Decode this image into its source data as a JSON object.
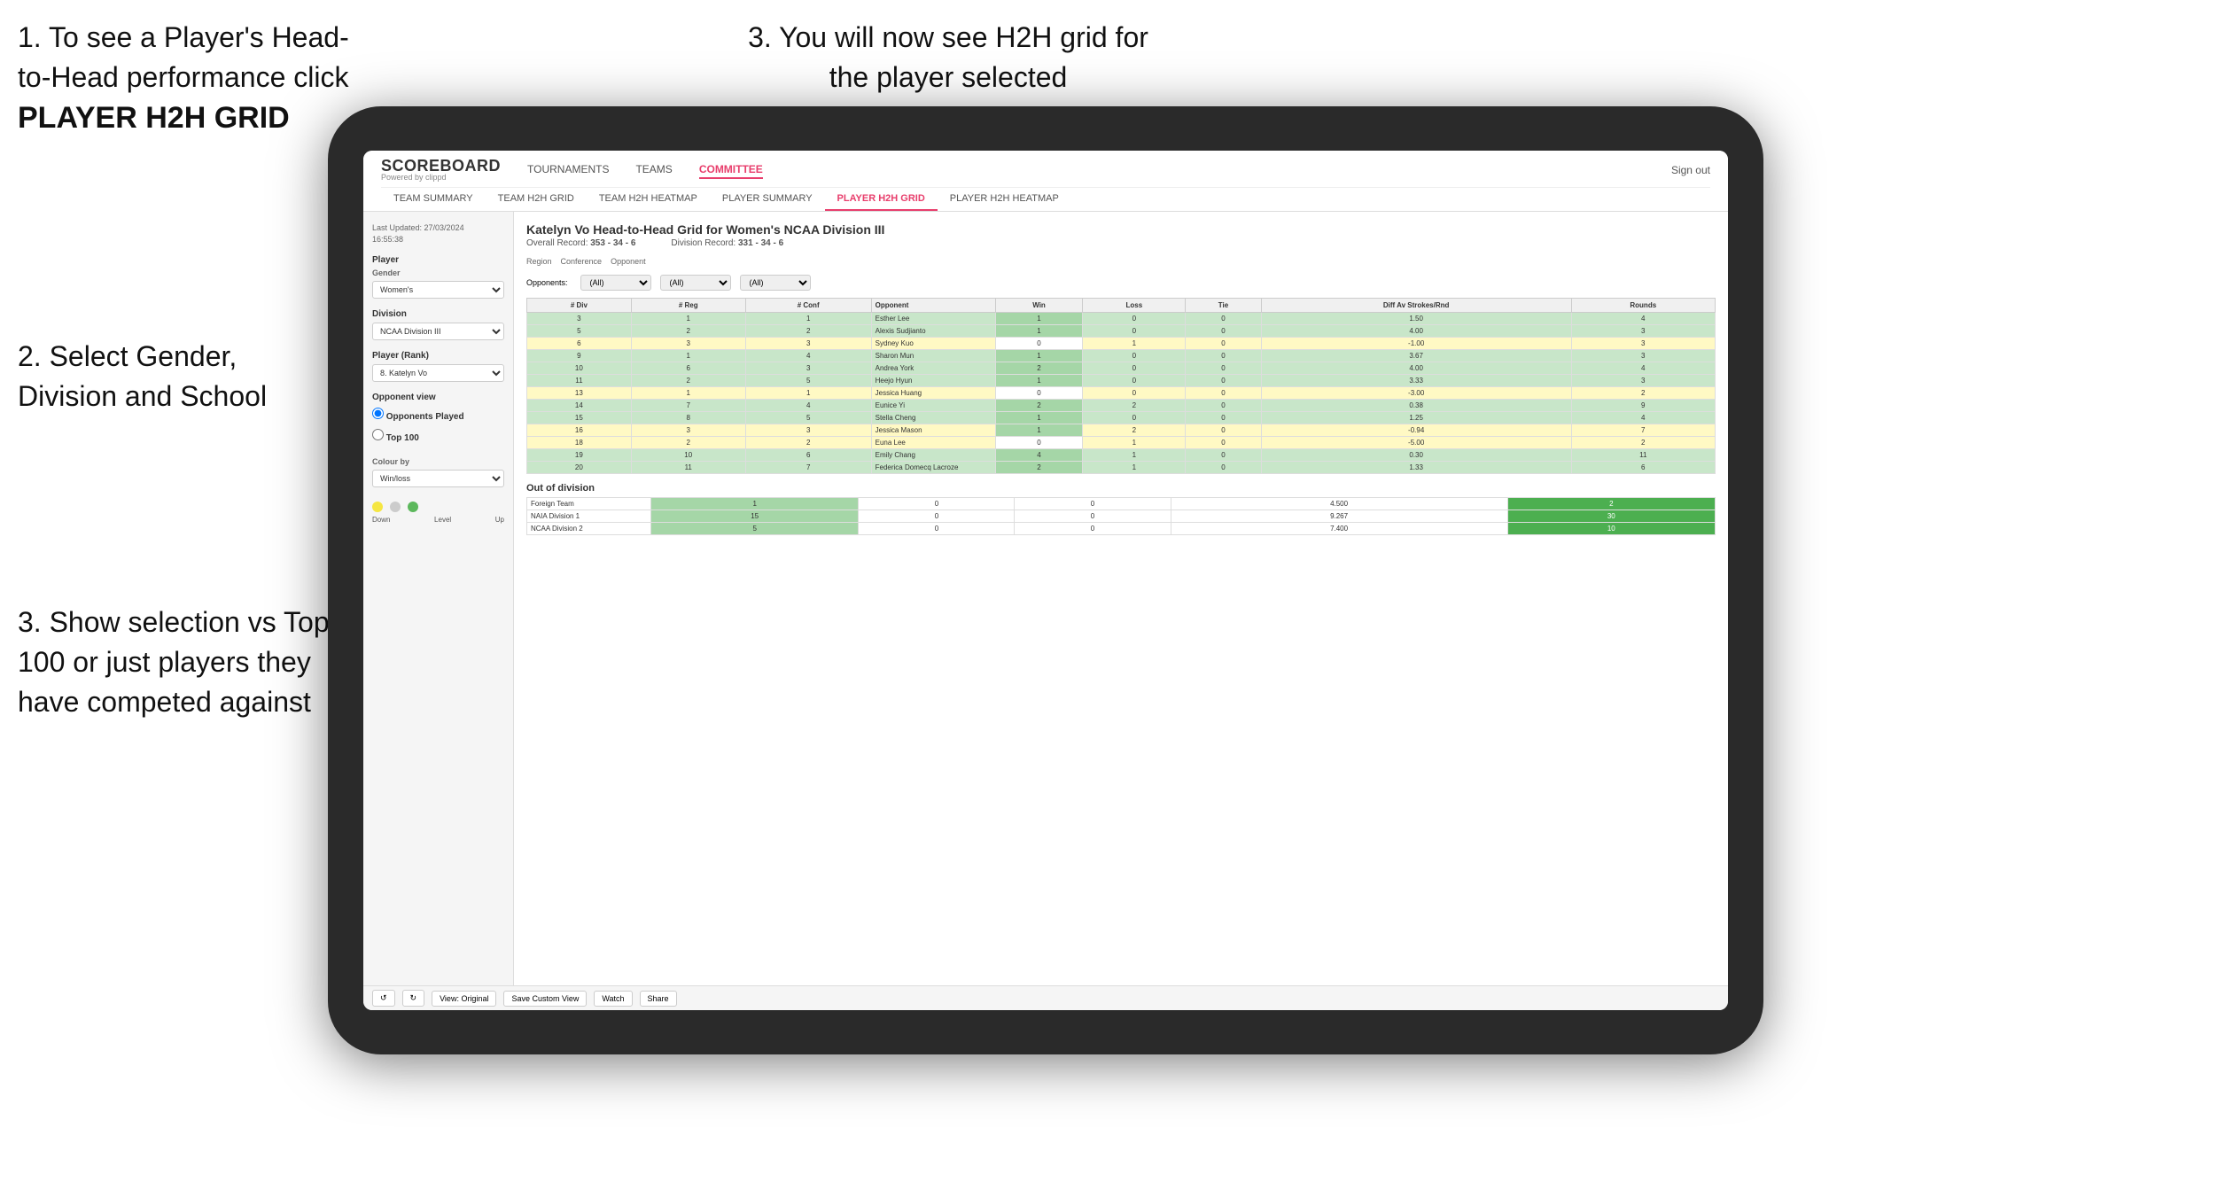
{
  "instructions": {
    "step1_text": "1. To see a Player's Head-to-Head performance click",
    "step1_bold": "PLAYER H2H GRID",
    "step2_text": "2. Select Gender, Division and School",
    "step3_left_text": "3. Show selection vs Top 100 or just players they have competed against",
    "step3_right_text": "3. You will now see H2H grid for the player selected"
  },
  "nav": {
    "logo": "SCOREBOARD",
    "logo_sub": "Powered by clippd",
    "links": [
      "TOURNAMENTS",
      "TEAMS",
      "COMMITTEE"
    ],
    "sign_out": "Sign out",
    "sub_links": [
      "TEAM SUMMARY",
      "TEAM H2H GRID",
      "TEAM H2H HEATMAP",
      "PLAYER SUMMARY",
      "PLAYER H2H GRID",
      "PLAYER H2H HEATMAP"
    ]
  },
  "sidebar": {
    "timestamp_label": "Last Updated: 27/03/2024",
    "timestamp_time": "16:55:38",
    "player_label": "Player",
    "gender_label": "Gender",
    "gender_value": "Women's",
    "division_label": "Division",
    "division_value": "NCAA Division III",
    "player_rank_label": "Player (Rank)",
    "player_rank_value": "8. Katelyn Vo",
    "opponent_view_label": "Opponent view",
    "radio1": "Opponents Played",
    "radio2": "Top 100",
    "colour_by_label": "Colour by",
    "colour_by_value": "Win/loss",
    "legend_down": "Down",
    "legend_level": "Level",
    "legend_up": "Up"
  },
  "grid": {
    "title": "Katelyn Vo Head-to-Head Grid for Women's NCAA Division III",
    "overall_record_label": "Overall Record:",
    "overall_record": "353 - 34 - 6",
    "division_record_label": "Division Record:",
    "division_record": "331 - 34 - 6",
    "filter_region_label": "Region",
    "filter_conference_label": "Conference",
    "filter_opponent_label": "Opponent",
    "filter_opponents_label": "Opponents:",
    "filter_all": "(All)",
    "col_div": "# Div",
    "col_reg": "# Reg",
    "col_conf": "# Conf",
    "col_opponent": "Opponent",
    "col_win": "Win",
    "col_loss": "Loss",
    "col_tie": "Tie",
    "col_diff": "Diff Av Strokes/Rnd",
    "col_rounds": "Rounds",
    "rows": [
      {
        "div": 3,
        "reg": 1,
        "conf": 1,
        "opponent": "Esther Lee",
        "win": 1,
        "loss": 0,
        "tie": 0,
        "diff": "1.50",
        "rounds": 4,
        "color": "green"
      },
      {
        "div": 5,
        "reg": 2,
        "conf": 2,
        "opponent": "Alexis Sudjianto",
        "win": 1,
        "loss": 0,
        "tie": 0,
        "diff": "4.00",
        "rounds": 3,
        "color": "green"
      },
      {
        "div": 6,
        "reg": 3,
        "conf": 3,
        "opponent": "Sydney Kuo",
        "win": 0,
        "loss": 1,
        "tie": 0,
        "diff": "-1.00",
        "rounds": 3,
        "color": "yellow"
      },
      {
        "div": 9,
        "reg": 1,
        "conf": 4,
        "opponent": "Sharon Mun",
        "win": 1,
        "loss": 0,
        "tie": 0,
        "diff": "3.67",
        "rounds": 3,
        "color": "green"
      },
      {
        "div": 10,
        "reg": 6,
        "conf": 3,
        "opponent": "Andrea York",
        "win": 2,
        "loss": 0,
        "tie": 0,
        "diff": "4.00",
        "rounds": 4,
        "color": "green"
      },
      {
        "div": 11,
        "reg": 2,
        "conf": 5,
        "opponent": "Heejo Hyun",
        "win": 1,
        "loss": 0,
        "tie": 0,
        "diff": "3.33",
        "rounds": 3,
        "color": "green"
      },
      {
        "div": 13,
        "reg": 1,
        "conf": 1,
        "opponent": "Jessica Huang",
        "win": 0,
        "loss": 0,
        "tie": 0,
        "diff": "-3.00",
        "rounds": 2,
        "color": "yellow"
      },
      {
        "div": 14,
        "reg": 7,
        "conf": 4,
        "opponent": "Eunice Yi",
        "win": 2,
        "loss": 2,
        "tie": 0,
        "diff": "0.38",
        "rounds": 9,
        "color": "green"
      },
      {
        "div": 15,
        "reg": 8,
        "conf": 5,
        "opponent": "Stella Cheng",
        "win": 1,
        "loss": 0,
        "tie": 0,
        "diff": "1.25",
        "rounds": 4,
        "color": "green"
      },
      {
        "div": 16,
        "reg": 3,
        "conf": 3,
        "opponent": "Jessica Mason",
        "win": 1,
        "loss": 2,
        "tie": 0,
        "diff": "-0.94",
        "rounds": 7,
        "color": "yellow"
      },
      {
        "div": 18,
        "reg": 2,
        "conf": 2,
        "opponent": "Euna Lee",
        "win": 0,
        "loss": 1,
        "tie": 0,
        "diff": "-5.00",
        "rounds": 2,
        "color": "yellow"
      },
      {
        "div": 19,
        "reg": 10,
        "conf": 6,
        "opponent": "Emily Chang",
        "win": 4,
        "loss": 1,
        "tie": 0,
        "diff": "0.30",
        "rounds": 11,
        "color": "green"
      },
      {
        "div": 20,
        "reg": 11,
        "conf": 7,
        "opponent": "Federica Domecq Lacroze",
        "win": 2,
        "loss": 1,
        "tie": 0,
        "diff": "1.33",
        "rounds": 6,
        "color": "green"
      }
    ],
    "out_of_division_label": "Out of division",
    "out_rows": [
      {
        "label": "Foreign Team",
        "win": 1,
        "loss": 0,
        "tie": 0,
        "diff": "4.500",
        "rounds": 2
      },
      {
        "label": "NAIA Division 1",
        "win": 15,
        "loss": 0,
        "tie": 0,
        "diff": "9.267",
        "rounds": 30
      },
      {
        "label": "NCAA Division 2",
        "win": 5,
        "loss": 0,
        "tie": 0,
        "diff": "7.400",
        "rounds": 10
      }
    ]
  },
  "toolbar": {
    "view_original": "View: Original",
    "save_custom": "Save Custom View",
    "watch": "Watch",
    "share": "Share"
  }
}
